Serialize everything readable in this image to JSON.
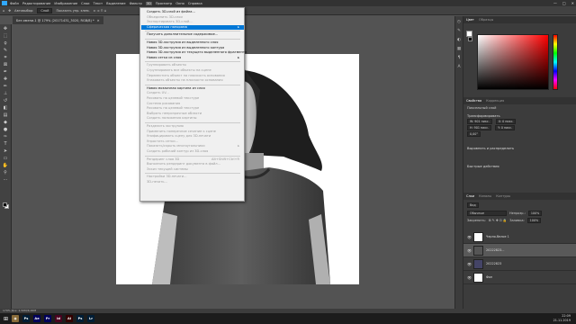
{
  "menubar": {
    "items": [
      "Файл",
      "Редактирование",
      "Изображение",
      "Слои",
      "Текст",
      "Выделение",
      "Фильтр",
      "3D",
      "Просмотр",
      "Окно",
      "Справка"
    ],
    "window_controls": [
      "—",
      "□",
      "✕"
    ]
  },
  "optbar": {
    "autoselect": "Автовыбор:",
    "layer": "Слой",
    "show_controls": "Показать упр. элем."
  },
  "doc_tab": {
    "title": "Без имени-1 @ 179% (20171431_3020, RGB/8) *",
    "close": "✕"
  },
  "menu3d": {
    "items": [
      {
        "label": "Создать 3D-слой из файла...",
        "disabled": false
      },
      {
        "label": "Объединить 3D-слои",
        "disabled": true
      },
      {
        "label": "Экспортировать 3D-слой...",
        "disabled": true
      },
      {
        "label": "Сферическая панорама",
        "disabled": false,
        "highlighted": true,
        "submenu": "▸"
      },
      {
        "sep": true
      },
      {
        "label": "Получить дополнительное содержимое...",
        "disabled": false
      },
      {
        "sep": true
      },
      {
        "label": "Новая 3D-экструзия из выделенного слоя",
        "disabled": false
      },
      {
        "label": "Новая 3D-экструзия из выделенного контура",
        "disabled": false
      },
      {
        "label": "Новая 3D-экструзия из текущего выделенного фрагмента",
        "disabled": false
      },
      {
        "label": "Новая сетка из слоя",
        "disabled": false,
        "submenu": "▸"
      },
      {
        "sep": true
      },
      {
        "label": "Группировать объекты",
        "disabled": true
      },
      {
        "label": "Сгруппировать все объекты на сцене",
        "disabled": true
      },
      {
        "label": "Переместить объект на плоскость основания",
        "disabled": true
      },
      {
        "label": "Упаковать объекты на плоскости основания",
        "disabled": true
      },
      {
        "sep": true
      },
      {
        "label": "Новая мозаичная картина из слоя",
        "disabled": false
      },
      {
        "label": "Создать UV...",
        "disabled": true
      },
      {
        "label": "Рисовать на целевой текстуре",
        "disabled": true
      },
      {
        "label": "Система рисования",
        "disabled": true
      },
      {
        "label": "Рисовать на целевой текстуре",
        "disabled": true
      },
      {
        "label": "Выбрать непрозрачные области",
        "disabled": true
      },
      {
        "label": "Создать наложения картины",
        "disabled": true
      },
      {
        "sep": true
      },
      {
        "label": "Разделить экструзию",
        "disabled": true
      },
      {
        "label": "Применить поперечное сечение к сцене",
        "disabled": true
      },
      {
        "label": "Унифицировать сцену для 3D-печати",
        "disabled": true
      },
      {
        "label": "Упростить сетки...",
        "disabled": true
      },
      {
        "label": "Показать/скрыть многоугольники",
        "disabled": true,
        "submenu": "▸"
      },
      {
        "label": "Создать рабочий контур из 3D-слоя",
        "disabled": true
      },
      {
        "sep": true
      },
      {
        "label": "Рендеринг слоя 3D",
        "disabled": true,
        "shortcut": "Alt+Shift+Ctrl+R"
      },
      {
        "label": "Выполнить рендеринг документа в файл...",
        "disabled": true
      },
      {
        "label": "Эскиз текущей системы",
        "disabled": true
      },
      {
        "sep": true
      },
      {
        "label": "Настройки 3D-печати...",
        "disabled": true
      },
      {
        "label": "3D-печать...",
        "disabled": true
      }
    ]
  },
  "panels": {
    "color_tabs": [
      "Цвет",
      "Образцы"
    ],
    "props_tabs": [
      "Свойства",
      "Коррекция"
    ],
    "props_kind": "Пиксельный слой",
    "transform_label": "Трансформировать",
    "transform_w": "W: 901 пикс.",
    "transform_h": "H: 901 пикс.",
    "transform_x": "X: 0 пикс.",
    "transform_y": "Y: 0 пикс.",
    "transform_angle": "0,00°",
    "align_label": "Выровнять и распределить",
    "quick_actions_label": "Быстрые действия",
    "layers_tabs": [
      "Слои",
      "Каналы",
      "Контуры"
    ],
    "layer_filter": "Вид",
    "blend_mode": "Обычные",
    "opacity_label": "Непрозр.:",
    "opacity": "100%",
    "lock_label": "Закрепить:",
    "fill_label": "Заливка:",
    "fill": "100%",
    "layers": [
      {
        "name": "Черно-белое 1",
        "selected": false,
        "thumb": "#ffffff"
      },
      {
        "name": "20222823...",
        "selected": true,
        "thumb": "#555555"
      },
      {
        "name": "20222823",
        "selected": false,
        "thumb": "#444466"
      },
      {
        "name": "Фон",
        "selected": false,
        "thumb": "#ffffff"
      }
    ]
  },
  "statusbar": {
    "text": "179%   Док: 2,50M/6,00M"
  },
  "taskbar": {
    "apps": [
      {
        "label": "◉",
        "color": "#8a6d3b"
      },
      {
        "label": "Ps",
        "color": "#001e36"
      },
      {
        "label": "Ae",
        "color": "#00005b"
      },
      {
        "label": "Pr",
        "color": "#00005b"
      },
      {
        "label": "Id",
        "color": "#49021f"
      },
      {
        "label": "Ai",
        "color": "#330000"
      },
      {
        "label": "Ps",
        "color": "#001e36"
      },
      {
        "label": "Lr",
        "color": "#001e36"
      }
    ]
  },
  "clock": {
    "time": "22:09",
    "date": "21.11.2019"
  }
}
